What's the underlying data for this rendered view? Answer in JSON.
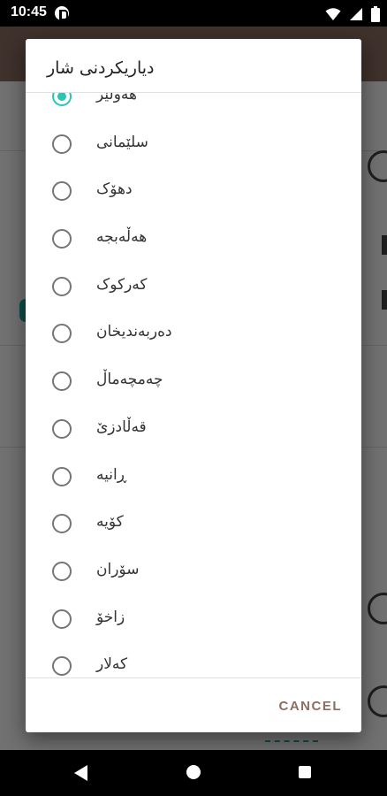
{
  "status_bar": {
    "time": "10:45"
  },
  "dialog": {
    "title": "دیاریکردنی شار",
    "cancel_label": "CANCEL",
    "accent_color": "#26c6b8",
    "items": [
      {
        "label": "هەولێر",
        "selected": true
      },
      {
        "label": "سلێمانی",
        "selected": false
      },
      {
        "label": "دهۆک",
        "selected": false
      },
      {
        "label": "هەڵەبجە",
        "selected": false
      },
      {
        "label": "کەرکوک",
        "selected": false
      },
      {
        "label": "دەربەندیخان",
        "selected": false
      },
      {
        "label": "چەمچەماڵ",
        "selected": false
      },
      {
        "label": "قەڵادزێ",
        "selected": false
      },
      {
        "label": "ڕانیە",
        "selected": false
      },
      {
        "label": "کۆیە",
        "selected": false
      },
      {
        "label": "سۆران",
        "selected": false
      },
      {
        "label": "زاخۆ",
        "selected": false
      },
      {
        "label": "کەلار",
        "selected": false
      }
    ]
  }
}
